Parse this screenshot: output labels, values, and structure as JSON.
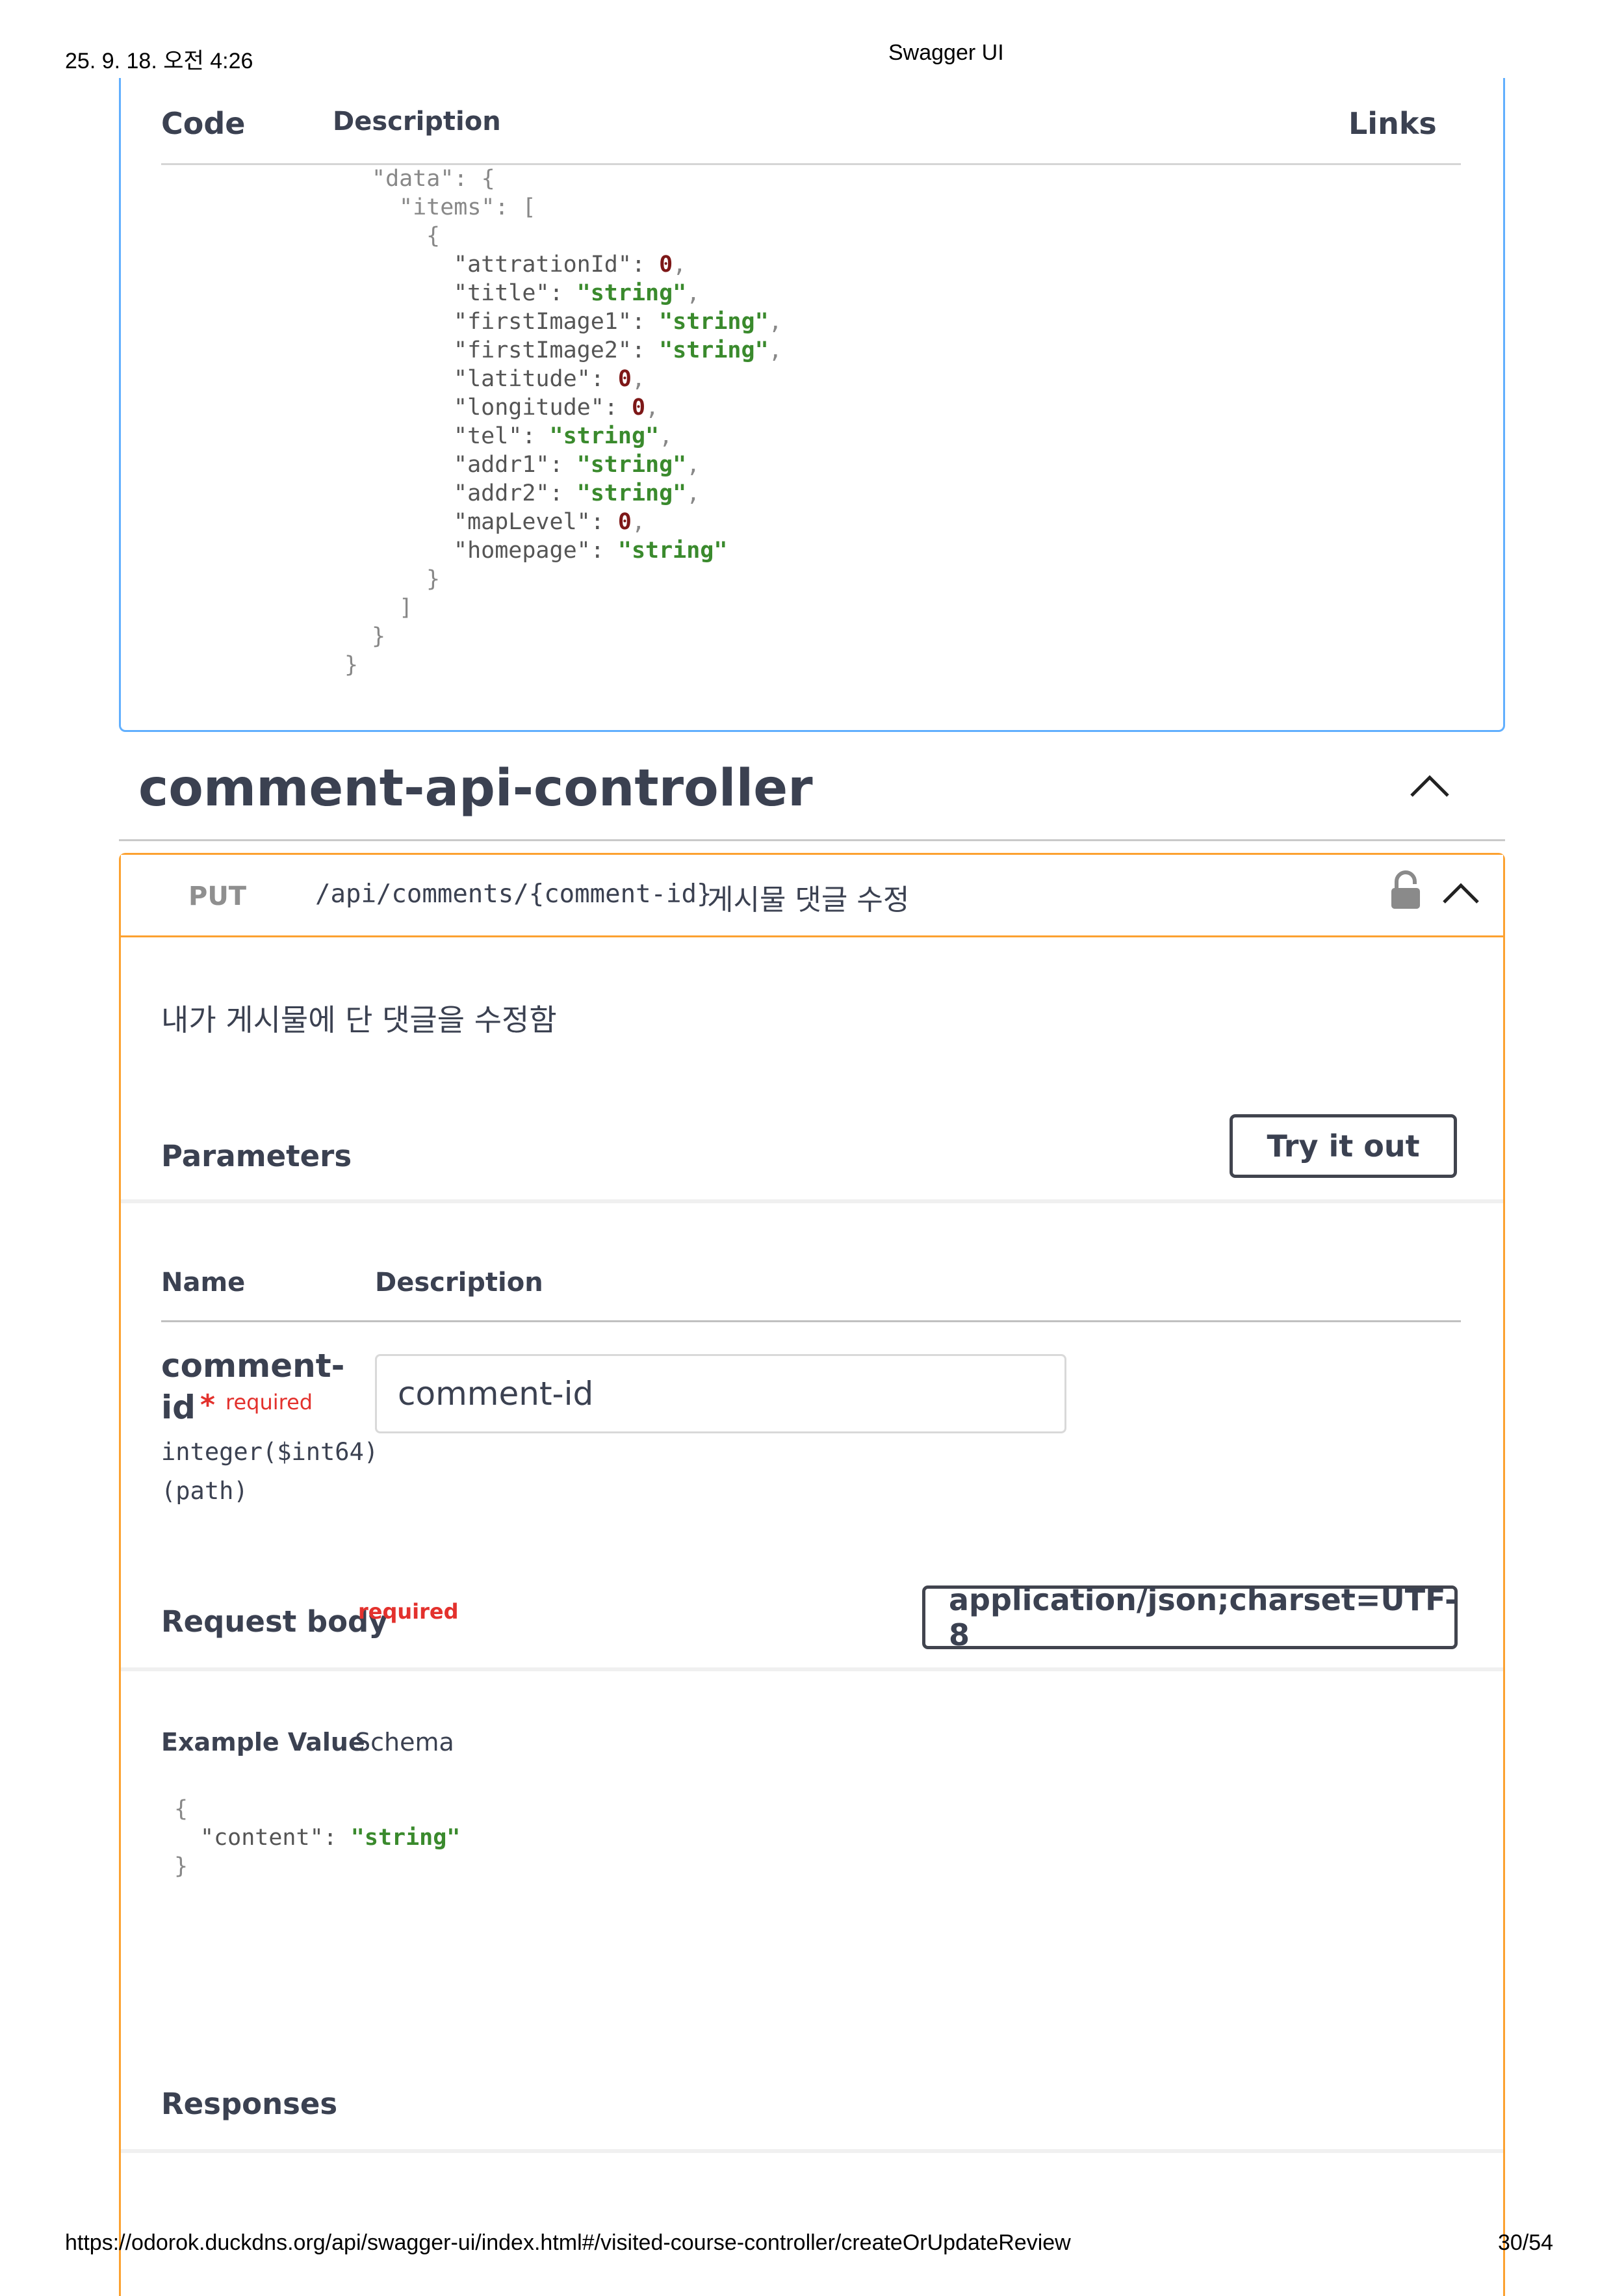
{
  "print_header": {
    "datetime": "25. 9. 18. 오전 4:26",
    "page_title": "Swagger UI"
  },
  "print_footer": {
    "url": "https://odorok.duckdns.org/api/swagger-ui/index.html#/visited-course-controller/createOrUpdateReview",
    "page": "30/54"
  },
  "response_table": {
    "col_code": "Code",
    "col_description": "Description",
    "col_links": "Links"
  },
  "response_example_lines": [
    {
      "indent": 0,
      "parts": [
        {
          "t": "p",
          "v": "\"data\": {"
        }
      ]
    },
    {
      "indent": 1,
      "parts": [
        {
          "t": "p",
          "v": "\"items\": ["
        }
      ]
    },
    {
      "indent": 2,
      "parts": [
        {
          "t": "p",
          "v": "{"
        }
      ]
    },
    {
      "indent": 3,
      "parts": [
        {
          "t": "k",
          "v": "\"attrationId\": "
        },
        {
          "t": "n",
          "v": "0"
        },
        {
          "t": "p",
          "v": ","
        }
      ]
    },
    {
      "indent": 3,
      "parts": [
        {
          "t": "k",
          "v": "\"title\": "
        },
        {
          "t": "s",
          "v": "\"string\""
        },
        {
          "t": "p",
          "v": ","
        }
      ]
    },
    {
      "indent": 3,
      "parts": [
        {
          "t": "k",
          "v": "\"firstImage1\": "
        },
        {
          "t": "s",
          "v": "\"string\""
        },
        {
          "t": "p",
          "v": ","
        }
      ]
    },
    {
      "indent": 3,
      "parts": [
        {
          "t": "k",
          "v": "\"firstImage2\": "
        },
        {
          "t": "s",
          "v": "\"string\""
        },
        {
          "t": "p",
          "v": ","
        }
      ]
    },
    {
      "indent": 3,
      "parts": [
        {
          "t": "k",
          "v": "\"latitude\": "
        },
        {
          "t": "n",
          "v": "0"
        },
        {
          "t": "p",
          "v": ","
        }
      ]
    },
    {
      "indent": 3,
      "parts": [
        {
          "t": "k",
          "v": "\"longitude\": "
        },
        {
          "t": "n",
          "v": "0"
        },
        {
          "t": "p",
          "v": ","
        }
      ]
    },
    {
      "indent": 3,
      "parts": [
        {
          "t": "k",
          "v": "\"tel\": "
        },
        {
          "t": "s",
          "v": "\"string\""
        },
        {
          "t": "p",
          "v": ","
        }
      ]
    },
    {
      "indent": 3,
      "parts": [
        {
          "t": "k",
          "v": "\"addr1\": "
        },
        {
          "t": "s",
          "v": "\"string\""
        },
        {
          "t": "p",
          "v": ","
        }
      ]
    },
    {
      "indent": 3,
      "parts": [
        {
          "t": "k",
          "v": "\"addr2\": "
        },
        {
          "t": "s",
          "v": "\"string\""
        },
        {
          "t": "p",
          "v": ","
        }
      ]
    },
    {
      "indent": 3,
      "parts": [
        {
          "t": "k",
          "v": "\"mapLevel\": "
        },
        {
          "t": "n",
          "v": "0"
        },
        {
          "t": "p",
          "v": ","
        }
      ]
    },
    {
      "indent": 3,
      "parts": [
        {
          "t": "k",
          "v": "\"homepage\": "
        },
        {
          "t": "s",
          "v": "\"string\""
        }
      ]
    },
    {
      "indent": 2,
      "parts": [
        {
          "t": "p",
          "v": "}"
        }
      ]
    },
    {
      "indent": 1,
      "parts": [
        {
          "t": "p",
          "v": "]"
        }
      ]
    },
    {
      "indent": 0,
      "parts": [
        {
          "t": "p",
          "v": "}"
        }
      ]
    },
    {
      "indent": -1,
      "parts": [
        {
          "t": "p",
          "v": "}"
        }
      ]
    }
  ],
  "controller": {
    "title": "comment-api-controller"
  },
  "operation": {
    "method": "PUT",
    "path": "/api/comments/{comment-id}",
    "summary": "게시물 댓글 수정",
    "description": "내가 게시물에 단 댓글을 수정함",
    "method_color": "#fca130"
  },
  "parameters": {
    "title": "Parameters",
    "try_label": "Try it out",
    "col_name": "Name",
    "col_description": "Description",
    "param": {
      "name_line1": "comment-",
      "name_line2": "id",
      "required_star": "*",
      "required_label": "required",
      "type": "integer($int64)",
      "location": "(path)",
      "input_placeholder": "comment-id"
    }
  },
  "request_body": {
    "title": "Request body",
    "required_label": "required",
    "content_type": "application/json;charset=UTF-8",
    "tab_example": "Example Value",
    "tab_schema": "Schema",
    "example_open": "{",
    "example_key": "\"content\": ",
    "example_value": "\"string\"",
    "example_close": "}"
  },
  "responses": {
    "title": "Responses"
  }
}
